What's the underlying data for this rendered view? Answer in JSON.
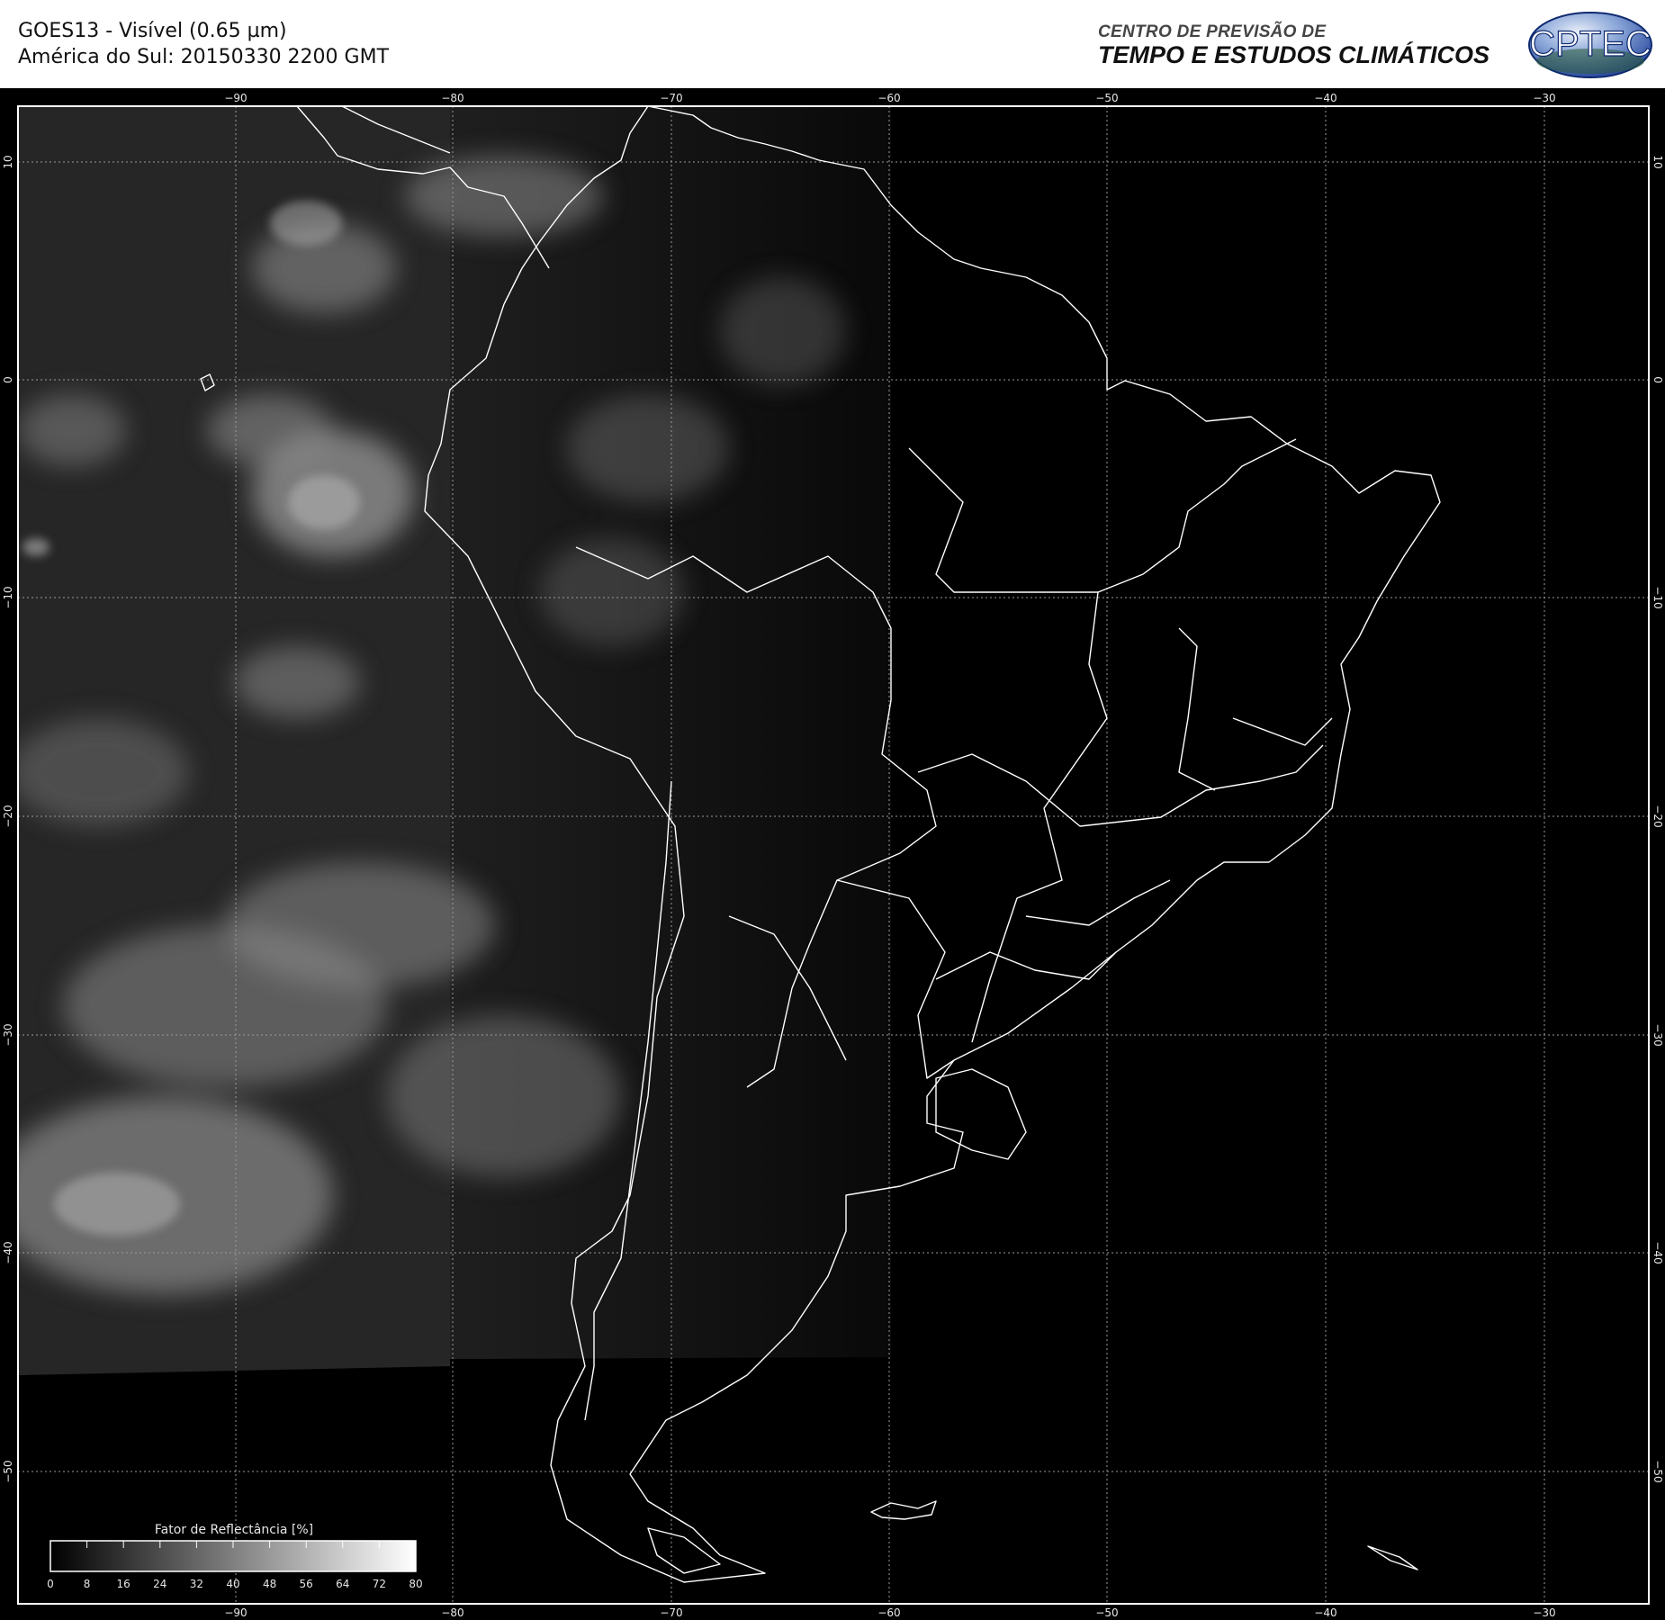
{
  "header": {
    "line1": "GOES13 - Visível (0.65 µm)",
    "line2": "América do Sul: 20150330 2200 GMT"
  },
  "org": {
    "line1": "CENTRO DE PREVISÃO DE",
    "line2": "TEMPO E ESTUDOS CLIMÁTICOS"
  },
  "logo": {
    "text": "CPTEC"
  },
  "colors": {
    "background": "#000000",
    "coastline": "#ffffff",
    "grid": "#9a9a9a",
    "logo_blue": "#1f3f96"
  },
  "map": {
    "longitudes": [
      -90,
      -80,
      -70,
      -60,
      -50,
      -40,
      -30
    ],
    "latitudes": [
      10,
      0,
      -10,
      -20,
      -30,
      -40,
      -50
    ],
    "lon_labels": [
      "−90",
      "−80",
      "−70",
      "−60",
      "−50",
      "−40",
      "−30"
    ],
    "lat_labels": [
      "10",
      "0",
      "−10",
      "−20",
      "−30",
      "−40",
      "−50"
    ],
    "grid": "dotted"
  },
  "legend": {
    "title": "Fator de Reflectância [%]",
    "ticks": [
      "0",
      "8",
      "16",
      "24",
      "32",
      "40",
      "48",
      "56",
      "64",
      "72",
      "80"
    ]
  }
}
